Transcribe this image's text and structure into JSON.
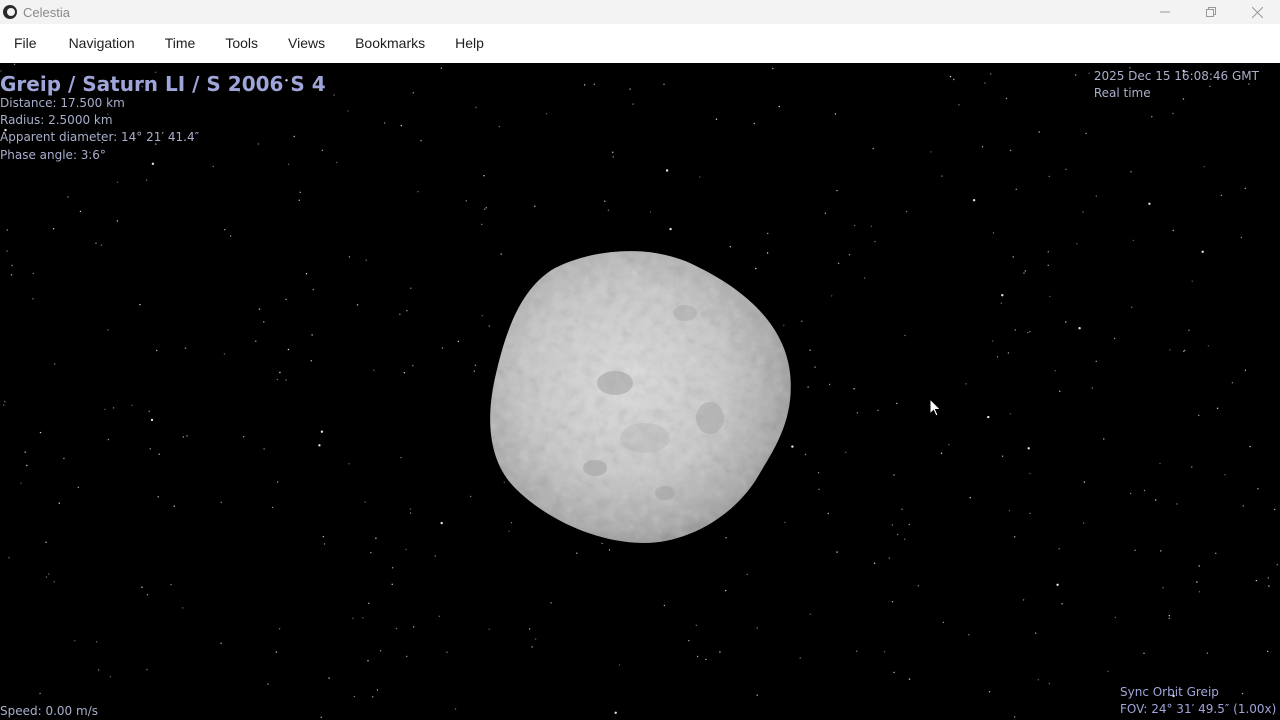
{
  "window": {
    "title": "Celestia",
    "icon": "celestia-app-icon",
    "controls": [
      "minimize-icon",
      "restore-icon",
      "close-icon"
    ]
  },
  "menu": {
    "items": [
      {
        "label": "File"
      },
      {
        "label": "Navigation"
      },
      {
        "label": "Time"
      },
      {
        "label": "Tools"
      },
      {
        "label": "Views"
      },
      {
        "label": "Bookmarks"
      },
      {
        "label": "Help"
      }
    ]
  },
  "object_info": {
    "name": "Greip / Saturn LI / S 2006 S 4",
    "distance": "Distance: 17.500 km",
    "radius": "Radius: 2.5000 km",
    "apparent_diameter": "Apparent diameter: 14° 21′ 41.4″",
    "phase_angle": "Phase angle: 3.6°"
  },
  "time_info": {
    "datetime": "2025 Dec 15 16:08:46 GMT",
    "mode": "Real time"
  },
  "status": {
    "speed": "Speed: 0.00 m/s",
    "sync": "Sync Orbit Greip",
    "fov": "FOV: 24° 31′ 49.5″ (1.00x)"
  },
  "colors": {
    "title_text": "#9fa5d9",
    "info_text": "#a9aeca",
    "background": "#000000"
  }
}
